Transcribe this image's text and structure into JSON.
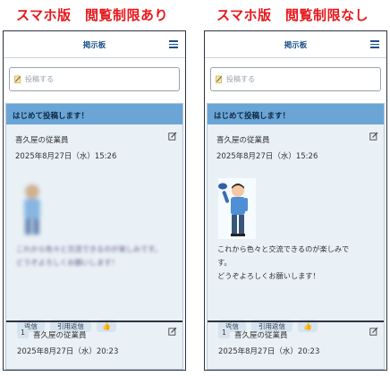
{
  "headings": {
    "left": "スマホ版　閲覧制限あり",
    "right": "スマホ版　閲覧制限なし"
  },
  "app": {
    "title": "掲示板",
    "composer_placeholder": "投稿する"
  },
  "thread": {
    "title": "はじめて投稿します！",
    "post": {
      "author": "喜久屋の従業員",
      "date": "2025年8月27日（水）15:26",
      "message_line1": "これから色々と交流できるのが楽しみです。",
      "message_line2": "どうぞよろしくお願いします！",
      "message_line1_right_a": "これから色々と交流できるのが楽しみで",
      "message_line1_right_b": "す。"
    },
    "buttons": {
      "reply": "返信",
      "quote_reply": "引用返信"
    },
    "reply": {
      "number": "1",
      "author": "喜久屋の従業員",
      "date": "2025年8月27日（水）20:23"
    }
  },
  "icons": {
    "menu": "hamburger-icon",
    "edit": "edit-icon",
    "like": "thumbs-up-icon",
    "compose": "pencil-icon"
  },
  "colors": {
    "heading": "#e8171b",
    "thread_header": "#6aa5d6",
    "thread_bg": "#e9f0f6",
    "button_bg": "#d7e3ee",
    "title": "#1b4f8a"
  }
}
